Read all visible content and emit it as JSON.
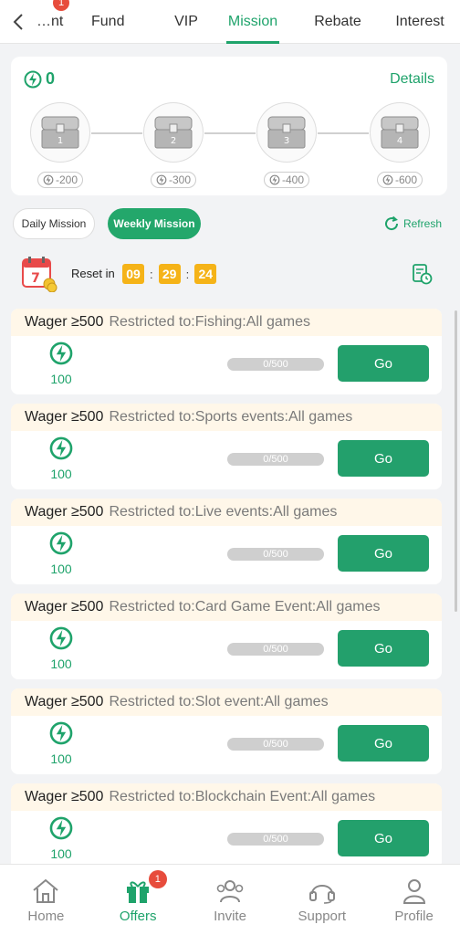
{
  "tabs": [
    {
      "label": "…nt",
      "badge": "1"
    },
    {
      "label": "Fund"
    },
    {
      "label": "VIP"
    },
    {
      "label": "Mission",
      "active": true
    },
    {
      "label": "Rebate"
    },
    {
      "label": "Interest"
    }
  ],
  "progress": {
    "points": "0",
    "details_label": "Details",
    "chests": [
      {
        "number": "1",
        "requirement": "-200"
      },
      {
        "number": "2",
        "requirement": "-300"
      },
      {
        "number": "3",
        "requirement": "-400"
      },
      {
        "number": "4",
        "requirement": "-600"
      }
    ]
  },
  "mission_tabs": {
    "daily": "Daily Mission",
    "weekly": "Weekly Mission",
    "refresh": "Refresh"
  },
  "reset": {
    "calendar_day": "7",
    "label": "Reset in",
    "hours": "09",
    "minutes": "29",
    "seconds": "24",
    "separator": ":"
  },
  "missions": [
    {
      "wager": "Wager ≥500",
      "restriction": "Restricted to:Fishing:All games",
      "reward": "100",
      "progress": "0/500",
      "progress_fraction": 0,
      "button": "Go"
    },
    {
      "wager": "Wager ≥500",
      "restriction": "Restricted to:Sports events:All games",
      "reward": "100",
      "progress": "0/500",
      "progress_fraction": 0,
      "button": "Go"
    },
    {
      "wager": "Wager ≥500",
      "restriction": "Restricted to:Live events:All games",
      "reward": "100",
      "progress": "0/500",
      "progress_fraction": 0,
      "button": "Go"
    },
    {
      "wager": "Wager ≥500",
      "restriction": "Restricted to:Card Game Event:All games",
      "reward": "100",
      "progress": "0/500",
      "progress_fraction": 0,
      "button": "Go"
    },
    {
      "wager": "Wager ≥500",
      "restriction": "Restricted to:Slot event:All games",
      "reward": "100",
      "progress": "0/500",
      "progress_fraction": 0,
      "button": "Go"
    },
    {
      "wager": "Wager ≥500",
      "restriction": "Restricted to:Blockchain Event:All games",
      "reward": "100",
      "progress": "0/500",
      "progress_fraction": 0,
      "button": "Go"
    }
  ],
  "bottom_nav": [
    {
      "label": "Home",
      "icon": "home-icon"
    },
    {
      "label": "Offers",
      "icon": "gift-icon",
      "active": true,
      "badge": "1"
    },
    {
      "label": "Invite",
      "icon": "invite-icon"
    },
    {
      "label": "Support",
      "icon": "headset-icon"
    },
    {
      "label": "Profile",
      "icon": "profile-icon"
    }
  ],
  "colors": {
    "accent": "#1fa36b",
    "button": "#23a06c",
    "timer": "#f5b318",
    "badge": "#e74c3c",
    "mission_header": "#fff7e9"
  }
}
